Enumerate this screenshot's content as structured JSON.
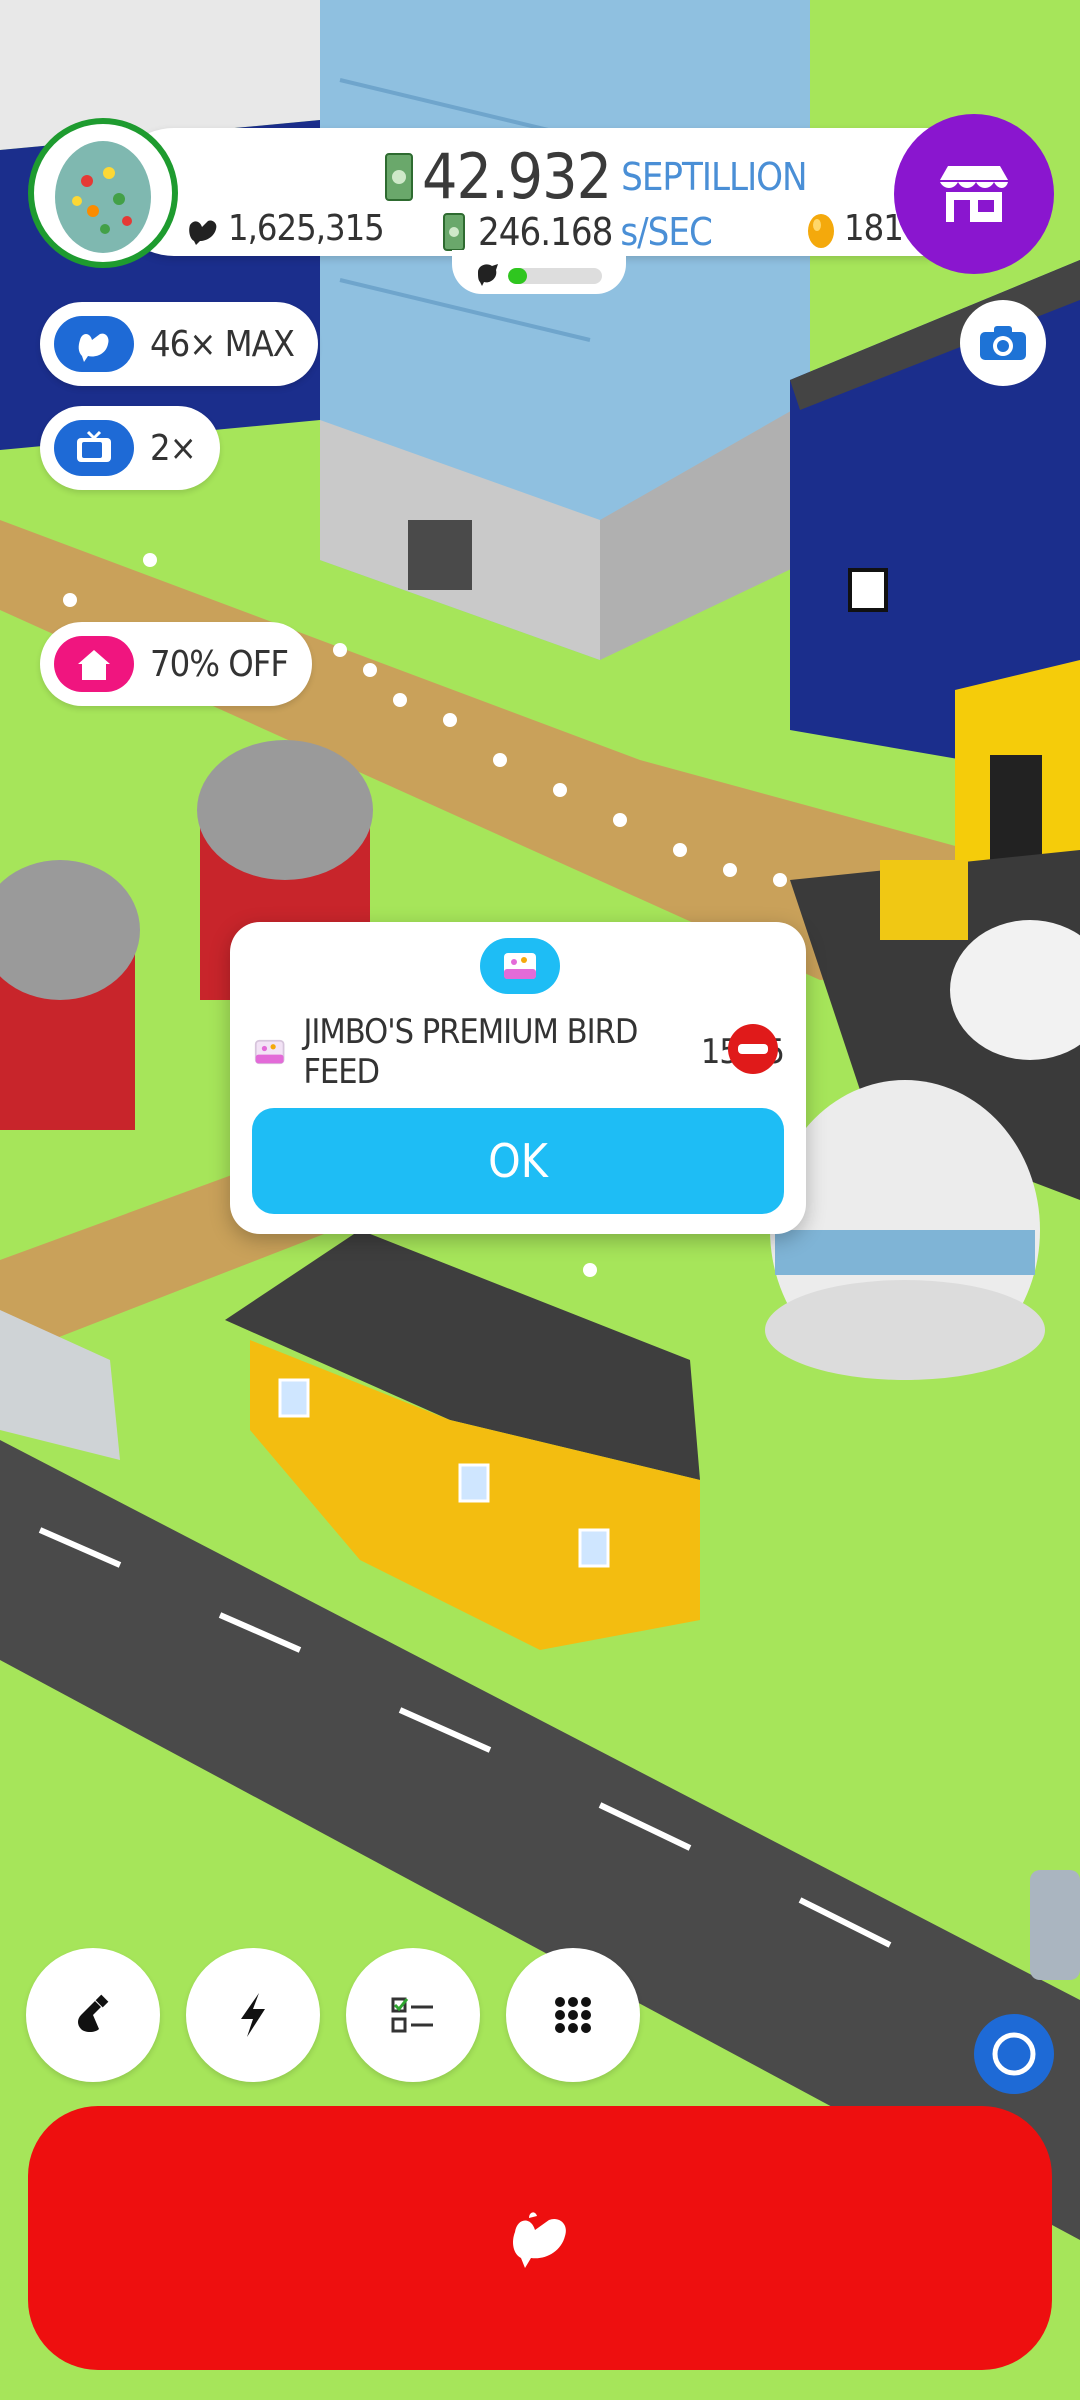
{
  "header": {
    "cash_amount": "42.932",
    "cash_unit": "SEPTILLION",
    "chicken_count": "1,625,315",
    "rate_value": "246.168",
    "rate_unit": "s/SEC",
    "egg_count": "181",
    "habitat_progress": 0.2
  },
  "sidebar": {
    "chicken_boost_label": "46× MAX",
    "video_boost_label": "2×",
    "sale_label": "70% OFF"
  },
  "dialog": {
    "boost_name": "JIMBO'S PREMIUM BIRD FEED",
    "boost_time": "15:25",
    "ok_label": "OK"
  },
  "colors": {
    "grass": "#a6e55a",
    "shop_purple": "#8a16cf",
    "dialog_blue": "#1ebdf5",
    "hatch_red": "#ee0f0f",
    "sale_pink": "#f0157f",
    "boost_blue": "#1e6ad6"
  },
  "icons": {
    "shop": "store-icon",
    "camera": "camera-icon",
    "hatch": "chicken-icon",
    "research": "flask-icon",
    "boosts": "lightning-icon",
    "missions": "checklist-icon",
    "menu": "grid-icon",
    "compass": "ring-icon"
  }
}
